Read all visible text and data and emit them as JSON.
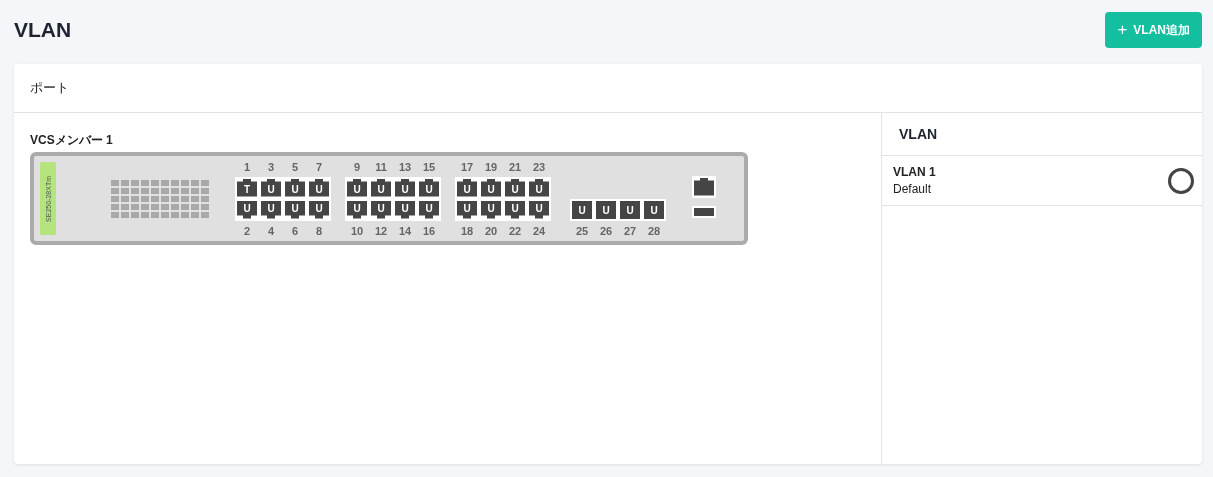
{
  "page": {
    "title": "VLAN",
    "add_button": {
      "icon": "+",
      "label": "VLAN追加"
    }
  },
  "card": {
    "title": "ポート",
    "switch": {
      "member_label": "VCSメンバー 1",
      "model": "SE250-28XTm",
      "groups": [
        {
          "kind": "paired",
          "columns": [
            {
              "top": {
                "number": "1",
                "mode": "T"
              },
              "bottom": {
                "number": "2",
                "mode": "U"
              }
            },
            {
              "top": {
                "number": "3",
                "mode": "U"
              },
              "bottom": {
                "number": "4",
                "mode": "U"
              }
            },
            {
              "top": {
                "number": "5",
                "mode": "U"
              },
              "bottom": {
                "number": "6",
                "mode": "U"
              }
            },
            {
              "top": {
                "number": "7",
                "mode": "U"
              },
              "bottom": {
                "number": "8",
                "mode": "U"
              }
            }
          ]
        },
        {
          "kind": "paired",
          "columns": [
            {
              "top": {
                "number": "9",
                "mode": "U"
              },
              "bottom": {
                "number": "10",
                "mode": "U"
              }
            },
            {
              "top": {
                "number": "11",
                "mode": "U"
              },
              "bottom": {
                "number": "12",
                "mode": "U"
              }
            },
            {
              "top": {
                "number": "13",
                "mode": "U"
              },
              "bottom": {
                "number": "14",
                "mode": "U"
              }
            },
            {
              "top": {
                "number": "15",
                "mode": "U"
              },
              "bottom": {
                "number": "16",
                "mode": "U"
              }
            }
          ]
        },
        {
          "kind": "paired",
          "columns": [
            {
              "top": {
                "number": "17",
                "mode": "U"
              },
              "bottom": {
                "number": "18",
                "mode": "U"
              }
            },
            {
              "top": {
                "number": "19",
                "mode": "U"
              },
              "bottom": {
                "number": "20",
                "mode": "U"
              }
            },
            {
              "top": {
                "number": "21",
                "mode": "U"
              },
              "bottom": {
                "number": "22",
                "mode": "U"
              }
            },
            {
              "top": {
                "number": "23",
                "mode": "U"
              },
              "bottom": {
                "number": "24",
                "mode": "U"
              }
            }
          ]
        },
        {
          "kind": "single",
          "ports": [
            {
              "number": "25",
              "mode": "U"
            },
            {
              "number": "26",
              "mode": "U"
            },
            {
              "number": "27",
              "mode": "U"
            },
            {
              "number": "28",
              "mode": "U"
            }
          ]
        }
      ]
    },
    "vlan_panel": {
      "title": "VLAN",
      "items": [
        {
          "name": "VLAN 1",
          "description": "Default",
          "selected": false
        }
      ]
    }
  }
}
